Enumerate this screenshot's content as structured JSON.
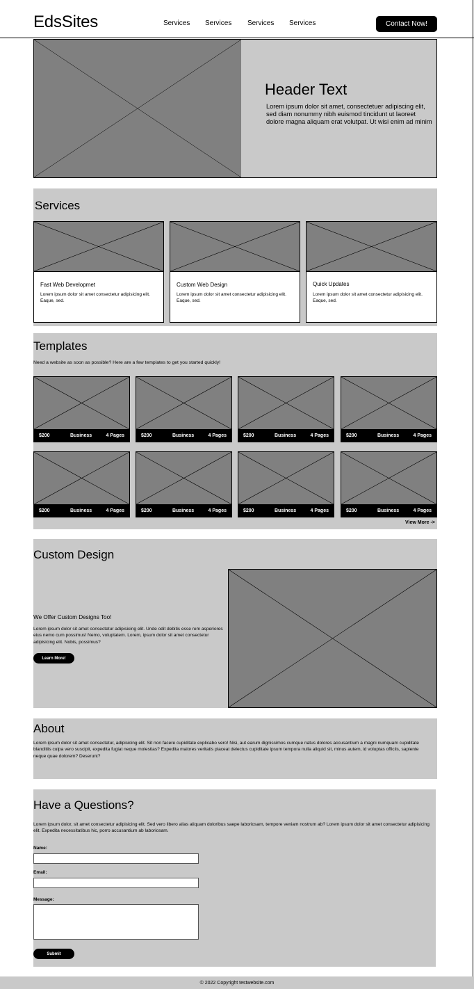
{
  "header": {
    "logo": "EdsSites",
    "nav": [
      "Services",
      "Services",
      "Services",
      "Services"
    ],
    "contact_label": "Contact Now!"
  },
  "hero": {
    "title": "Header Text",
    "body": "Lorem ipsum dolor sit amet, consectetuer adipiscing elit, sed diam nonummy nibh euismod tincidunt ut laoreet dolore magna aliquam erat volutpat. Ut wisi enim ad minim"
  },
  "services": {
    "title": "Services",
    "cards": [
      {
        "title": "Fast Web Developmet",
        "body": "Lorem ipsum dolor sit amet consectetur adipisicing elit. Eaque, sed."
      },
      {
        "title": "Custom Web Design",
        "body": "Lorem ipsum dolor sit amet consectetur adipisicing elit. Eaque, sed."
      },
      {
        "title": "Quick Updates",
        "body": "Lorem ipsum dolor sit amet consectetur adipisicing elit. Eaque, sed."
      }
    ]
  },
  "templates": {
    "title": "Templates",
    "subtitle": "Need a website as soon as possible? Here are a few templates to get you started quickly!",
    "items": [
      {
        "price": "$200",
        "category": "Business",
        "pages": "4 Pages"
      },
      {
        "price": "$200",
        "category": "Business",
        "pages": "4 Pages"
      },
      {
        "price": "$200",
        "category": "Business",
        "pages": "4 Pages"
      },
      {
        "price": "$200",
        "category": "Business",
        "pages": "4 Pages"
      },
      {
        "price": "$200",
        "category": "Business",
        "pages": "4 Pages"
      },
      {
        "price": "$200",
        "category": "Business",
        "pages": "4 Pages"
      },
      {
        "price": "$200",
        "category": "Business",
        "pages": "4 Pages"
      },
      {
        "price": "$200",
        "category": "Business",
        "pages": "4 Pages"
      }
    ],
    "view_more": "View More ->"
  },
  "custom_design": {
    "title": "Custom Design",
    "subtitle": "We Offer Custom Designs Too!",
    "body": "Lorem ipsum dolor sit amet consectetur adipisicing elit. Unde odit debitis esse rem asperiores eius nemo cum possimus! Nemo, voluptatem. Lorem, ipsum dolor sit amet consectetur adipisicing elit. Nobis, possimus?",
    "button_label": "Learn More!"
  },
  "about": {
    "title": "About",
    "body": "Lorem ipsum dolor sit amet consectetur, adipisicing elit. Sit non facere cupiditate explicabo vero! Nisi, aut earum dignissimos cumque natus dolores accusantium a magni numquam cupiditate blanditiis culpa vero suscipit, expedita fugiat neque molestias? Expedita maiores veritatis placeat delectus cupiditate ipsum tempora nulla aliquid sit, minus autem, id voluptas officiis, sapiente neque quae dolorem? Deserunt?"
  },
  "contact": {
    "title": "Have a Questions?",
    "body": "Lorem ipsum dolor, sit amet consectetur adipisicing elit. Sed vero libero alias aliquam doloribus saepe laboriosam, tempore veniam nostrum ab? Lorem ipsum dolor sit amet consectetur adipisicing elit. Expedita necessitatibus hic, porro accusantium ab laboriosam.",
    "name_label": "Name:",
    "name_value": "",
    "email_label": "Email:",
    "email_value": "",
    "message_label": "Message:",
    "message_value": "",
    "submit_label": "Submit"
  },
  "footer": {
    "copyright": "© 2022 Copyright testwebsite.com"
  }
}
